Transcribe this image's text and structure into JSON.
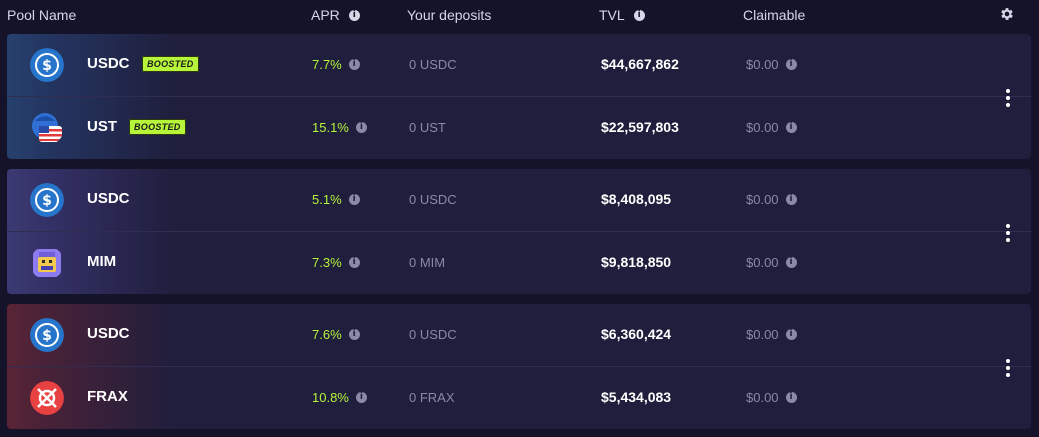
{
  "header": {
    "pool_name": "Pool Name",
    "apr": "APR",
    "your_deposits": "Your deposits",
    "tvl": "TVL",
    "claimable": "Claimable"
  },
  "colors": {
    "accent_green": "#b7f53a",
    "background": "#14132a",
    "card": "#1f1e3c",
    "muted_text": "#8a89a6"
  },
  "groups": [
    {
      "rows": [
        {
          "token": "USDC",
          "icon": "usdc-icon",
          "badge": "BOOSTED",
          "apr": "7.7%",
          "deposit": "0 USDC",
          "tvl": "$44,667,862",
          "claimable": "$0.00"
        },
        {
          "token": "UST",
          "icon": "ust-icon",
          "badge": "BOOSTED",
          "apr": "15.1%",
          "deposit": "0 UST",
          "tvl": "$22,597,803",
          "claimable": "$0.00"
        }
      ]
    },
    {
      "rows": [
        {
          "token": "USDC",
          "icon": "usdc-icon",
          "apr": "5.1%",
          "deposit": "0 USDC",
          "tvl": "$8,408,095",
          "claimable": "$0.00"
        },
        {
          "token": "MIM",
          "icon": "mim-icon",
          "apr": "7.3%",
          "deposit": "0 MIM",
          "tvl": "$9,818,850",
          "claimable": "$0.00"
        }
      ]
    },
    {
      "rows": [
        {
          "token": "USDC",
          "icon": "usdc-icon",
          "apr": "7.6%",
          "deposit": "0 USDC",
          "tvl": "$6,360,424",
          "claimable": "$0.00"
        },
        {
          "token": "FRAX",
          "icon": "frax-icon",
          "apr": "10.8%",
          "deposit": "0 FRAX",
          "tvl": "$5,434,083",
          "claimable": "$0.00"
        }
      ]
    }
  ]
}
